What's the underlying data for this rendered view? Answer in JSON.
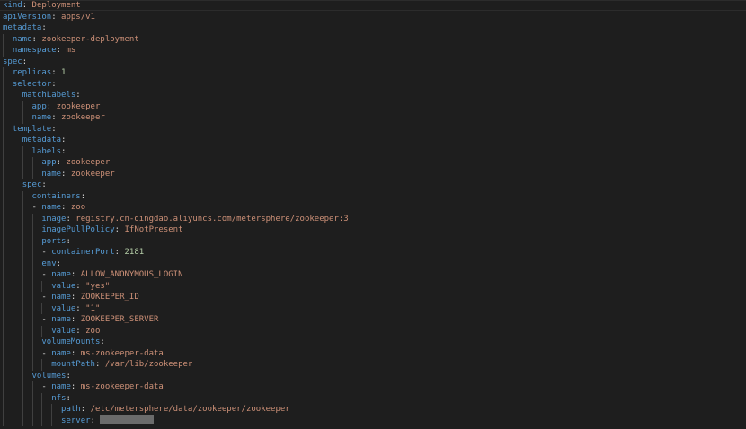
{
  "lines": [
    {
      "indent": 0,
      "dash": false,
      "key": "kind",
      "value": "Deployment",
      "type": "str"
    },
    {
      "indent": 0,
      "dash": false,
      "key": "apiVersion",
      "value": "apps/v1",
      "type": "str"
    },
    {
      "indent": 0,
      "dash": false,
      "key": "metadata",
      "value": "",
      "type": "none"
    },
    {
      "indent": 1,
      "dash": false,
      "key": "name",
      "value": "zookeeper-deployment",
      "type": "str"
    },
    {
      "indent": 1,
      "dash": false,
      "key": "namespace",
      "value": "ms",
      "type": "str"
    },
    {
      "indent": 0,
      "dash": false,
      "key": "spec",
      "value": "",
      "type": "none"
    },
    {
      "indent": 1,
      "dash": false,
      "key": "replicas",
      "value": "1",
      "type": "num"
    },
    {
      "indent": 1,
      "dash": false,
      "key": "selector",
      "value": "",
      "type": "none"
    },
    {
      "indent": 2,
      "dash": false,
      "key": "matchLabels",
      "value": "",
      "type": "none"
    },
    {
      "indent": 3,
      "dash": false,
      "key": "app",
      "value": "zookeeper",
      "type": "str"
    },
    {
      "indent": 3,
      "dash": false,
      "key": "name",
      "value": "zookeeper",
      "type": "str"
    },
    {
      "indent": 1,
      "dash": false,
      "key": "template",
      "value": "",
      "type": "none"
    },
    {
      "indent": 2,
      "dash": false,
      "key": "metadata",
      "value": "",
      "type": "none"
    },
    {
      "indent": 3,
      "dash": false,
      "key": "labels",
      "value": "",
      "type": "none"
    },
    {
      "indent": 4,
      "dash": false,
      "key": "app",
      "value": "zookeeper",
      "type": "str"
    },
    {
      "indent": 4,
      "dash": false,
      "key": "name",
      "value": "zookeeper",
      "type": "str"
    },
    {
      "indent": 2,
      "dash": false,
      "key": "spec",
      "value": "",
      "type": "none"
    },
    {
      "indent": 3,
      "dash": false,
      "key": "containers",
      "value": "",
      "type": "none"
    },
    {
      "indent": 3,
      "dash": true,
      "key": "name",
      "value": "zoo",
      "type": "str"
    },
    {
      "indent": 4,
      "dash": false,
      "key": "image",
      "value": "registry.cn-qingdao.aliyuncs.com/metersphere/zookeeper:3",
      "type": "str"
    },
    {
      "indent": 4,
      "dash": false,
      "key": "imagePullPolicy",
      "value": "IfNotPresent",
      "type": "str"
    },
    {
      "indent": 4,
      "dash": false,
      "key": "ports",
      "value": "",
      "type": "none"
    },
    {
      "indent": 4,
      "dash": true,
      "key": "containerPort",
      "value": "2181",
      "type": "num"
    },
    {
      "indent": 4,
      "dash": false,
      "key": "env",
      "value": "",
      "type": "none"
    },
    {
      "indent": 4,
      "dash": true,
      "key": "name",
      "value": "ALLOW_ANONYMOUS_LOGIN",
      "type": "str"
    },
    {
      "indent": 5,
      "dash": false,
      "key": "value",
      "value": "\"yes\"",
      "type": "str"
    },
    {
      "indent": 4,
      "dash": true,
      "key": "name",
      "value": "ZOOKEEPER_ID",
      "type": "str"
    },
    {
      "indent": 5,
      "dash": false,
      "key": "value",
      "value": "\"1\"",
      "type": "str"
    },
    {
      "indent": 4,
      "dash": true,
      "key": "name",
      "value": "ZOOKEEPER_SERVER",
      "type": "str"
    },
    {
      "indent": 5,
      "dash": false,
      "key": "value",
      "value": "zoo",
      "type": "str"
    },
    {
      "indent": 4,
      "dash": false,
      "key": "volumeMounts",
      "value": "",
      "type": "none"
    },
    {
      "indent": 4,
      "dash": true,
      "key": "name",
      "value": "ms-zookeeper-data",
      "type": "str"
    },
    {
      "indent": 5,
      "dash": false,
      "key": "mountPath",
      "value": "/var/lib/zookeeper",
      "type": "str"
    },
    {
      "indent": 3,
      "dash": false,
      "key": "volumes",
      "value": "",
      "type": "none"
    },
    {
      "indent": 4,
      "dash": true,
      "key": "name",
      "value": "ms-zookeeper-data",
      "type": "str"
    },
    {
      "indent": 5,
      "dash": false,
      "key": "nfs",
      "value": "",
      "type": "none"
    },
    {
      "indent": 6,
      "dash": false,
      "key": "path",
      "value": "/etc/metersphere/data/zookeeper/zookeeper",
      "type": "str"
    },
    {
      "indent": 6,
      "dash": false,
      "key": "server",
      "value": "",
      "type": "masked"
    }
  ],
  "colors": {
    "background": "#1e1e1e",
    "key": "#569cd6",
    "string": "#ce9178",
    "number": "#b5cea8",
    "punctuation": "#d4d4d4",
    "indent_guide": "#404040"
  }
}
